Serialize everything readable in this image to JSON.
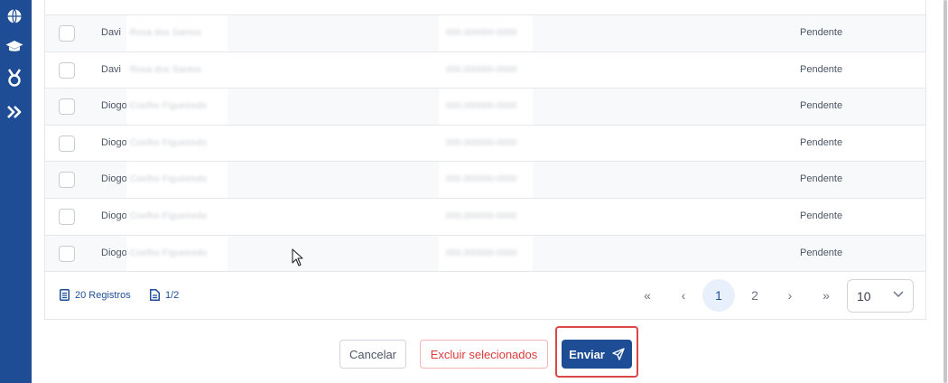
{
  "sidebar": {
    "icons": [
      "globe-icon",
      "graduation-cap-icon",
      "medal-icon",
      "expand-chevrons-icon"
    ]
  },
  "table": {
    "rows": [
      {
        "first_name": "Davi",
        "name_rest": "Rosa dos Santos",
        "document": "000.000000-0000",
        "status": "Pendente"
      },
      {
        "first_name": "Davi",
        "name_rest": "Rosa dos Santos",
        "document": "000.000000-0000",
        "status": "Pendente"
      },
      {
        "first_name": "Diogo",
        "name_rest": "Coelho Figueiredo",
        "document": "000.000000-0000",
        "status": "Pendente"
      },
      {
        "first_name": "Diogo",
        "name_rest": "Coelho Figueiredo",
        "document": "000.000000-0000",
        "status": "Pendente"
      },
      {
        "first_name": "Diogo",
        "name_rest": "Coelho Figueiredo",
        "document": "000.000000-0000",
        "status": "Pendente"
      },
      {
        "first_name": "Diogo",
        "name_rest": "Coelho Figueiredo",
        "document": "000.000000-0000",
        "status": "Pendente"
      },
      {
        "first_name": "Diogo",
        "name_rest": "Coelho Figueiredo",
        "document": "000.000000-0000",
        "status": "Pendente"
      }
    ]
  },
  "footer": {
    "records_label": "20 Registros",
    "pages_label": "1/2",
    "pagination": {
      "first": "«",
      "prev": "‹",
      "pages": [
        "1",
        "2"
      ],
      "current_page": "1",
      "next": "›",
      "last": "»"
    },
    "per_page": "10"
  },
  "actions": {
    "cancel_label": "Cancelar",
    "delete_label": "Excluir selecionados",
    "send_label": "Enviar"
  },
  "colors": {
    "primary": "#1e4d96",
    "danger": "#dc3c3c",
    "highlight": "#d94848"
  }
}
